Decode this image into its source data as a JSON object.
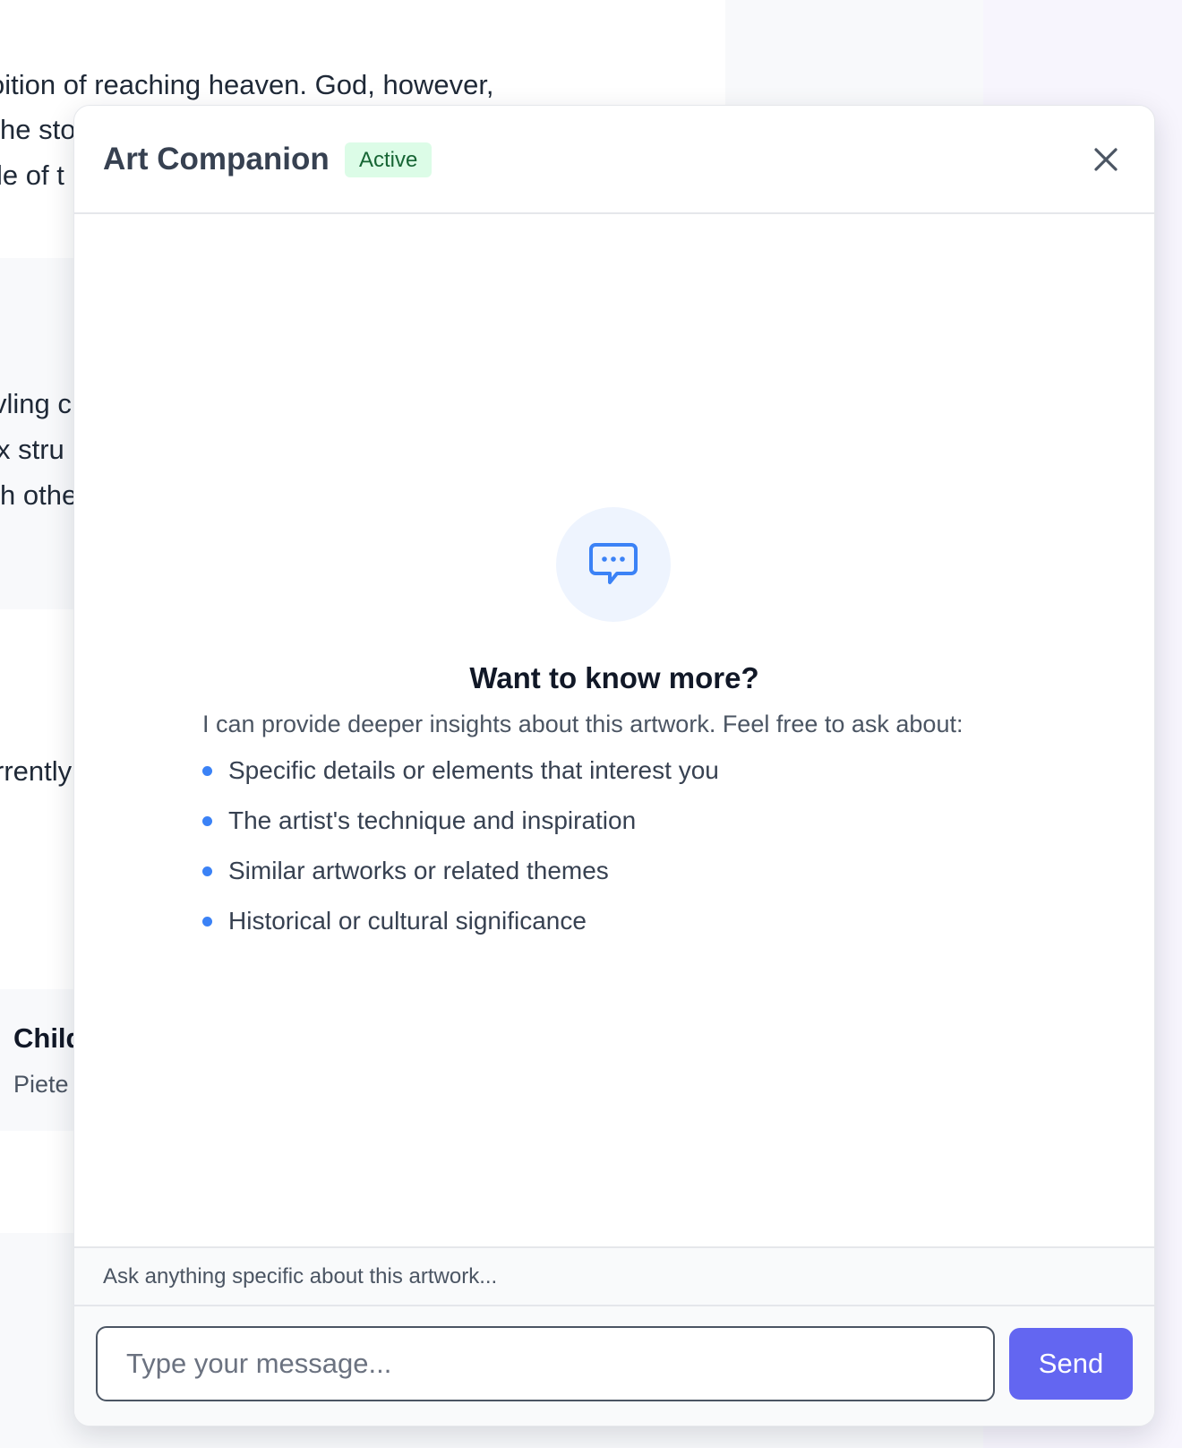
{
  "background_page": {
    "paragraph_1": [
      "oition of reaching heaven. God, however,",
      "he sto",
      "le of t"
    ],
    "paragraph_2": [
      "vling c",
      "x stru",
      "h othe"
    ],
    "paragraph_3": [
      "rrently"
    ],
    "card": {
      "title": "Child",
      "subtitle": "Piete"
    }
  },
  "chat": {
    "title": "Art Companion",
    "status": "Active",
    "close_icon": "close-icon",
    "empty_state": {
      "icon": "chat-bubble-icon",
      "heading": "Want to know more?",
      "intro": "I can provide deeper insights about this artwork. Feel free to ask about:",
      "suggestions": [
        "Specific details or elements that interest you",
        "The artist's technique and inspiration",
        "Similar artworks or related themes",
        "Historical or cultural significance"
      ]
    },
    "hint": "Ask anything specific about this artwork...",
    "input": {
      "placeholder": "Type your message...",
      "value": ""
    },
    "send_label": "Send"
  },
  "colors": {
    "accent": "#6366f1",
    "bullet": "#3b82f6",
    "badge_bg": "#dcfce7",
    "badge_text": "#166534"
  }
}
